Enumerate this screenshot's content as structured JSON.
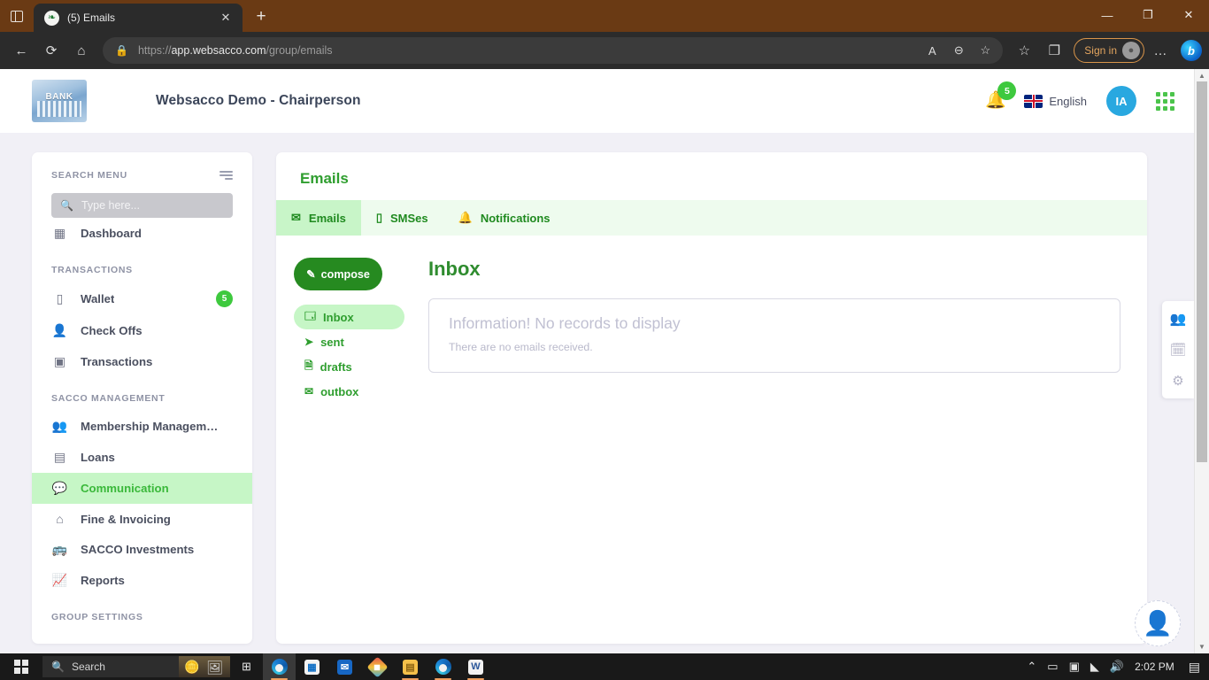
{
  "browser": {
    "tab_title": "(5) Emails",
    "tab_favicon": "leaf-icon",
    "new_tab_label": "+",
    "close_label": "✕",
    "minimize_label": "—",
    "maximize_label": "❐",
    "window_close_label": "✕",
    "back_label": "←",
    "reload_label": "⟳",
    "home_label": "⌂",
    "lock_label": "🔒",
    "url_prefix": "https://",
    "url_domain": "app.websacco.com",
    "url_path": "/group/emails",
    "read_aloud_label": "A",
    "zoom_label": "⊖",
    "add_favorite_label": "☆",
    "favorites_label": "☆",
    "collections_label": "❐",
    "signin_label": "Sign in",
    "more_label": "…",
    "bing_label": "b"
  },
  "app": {
    "logo_text": "BANK",
    "title": "Websacco Demo - Chairperson",
    "notification_count": "5",
    "language": "English",
    "avatar_initials": "IA"
  },
  "sidebar": {
    "search_header": "SEARCH MENU",
    "search_placeholder": "Type here...",
    "sections": [
      {
        "label": "",
        "items": [
          {
            "label": "Dashboard",
            "icon": "dashboard-icon",
            "badge": "",
            "active": false
          }
        ]
      },
      {
        "label": "TRANSACTIONS",
        "items": [
          {
            "label": "Wallet",
            "icon": "wallet-icon",
            "badge": "5",
            "active": false
          },
          {
            "label": "Check Offs",
            "icon": "check-offs-icon",
            "badge": "",
            "active": false
          },
          {
            "label": "Transactions",
            "icon": "transactions-icon",
            "badge": "",
            "active": false
          }
        ]
      },
      {
        "label": "SACCO MANAGEMENT",
        "items": [
          {
            "label": "Membership Managem…",
            "icon": "membership-icon",
            "badge": "",
            "active": false
          },
          {
            "label": "Loans",
            "icon": "loans-icon",
            "badge": "",
            "active": false
          },
          {
            "label": "Communication",
            "icon": "communication-icon",
            "badge": "",
            "active": true
          },
          {
            "label": "Fine & Invoicing",
            "icon": "fine-invoicing-icon",
            "badge": "",
            "active": false
          },
          {
            "label": "SACCO Investments",
            "icon": "investments-icon",
            "badge": "",
            "active": false
          },
          {
            "label": "Reports",
            "icon": "reports-icon",
            "badge": "",
            "active": false
          }
        ]
      },
      {
        "label": "GROUP SETTINGS",
        "items": []
      }
    ]
  },
  "main": {
    "card_title": "Emails",
    "tabs": [
      {
        "label": "Emails",
        "icon": "envelope-check-icon",
        "active": true
      },
      {
        "label": "SMSes",
        "icon": "mobile-icon",
        "active": false
      },
      {
        "label": "Notifications",
        "icon": "bell-icon",
        "active": false
      }
    ],
    "compose_label": "compose",
    "folders": [
      {
        "label": "Inbox",
        "icon": "inbox-icon",
        "active": true
      },
      {
        "label": "sent",
        "icon": "send-icon",
        "active": false
      },
      {
        "label": "drafts",
        "icon": "file-icon",
        "active": false
      },
      {
        "label": "outbox",
        "icon": "envelope-icon",
        "active": false
      }
    ],
    "inbox_title": "Inbox",
    "alert_title": "Information! No records to display",
    "alert_subtitle": "There are no emails received."
  },
  "widgets": {
    "items": [
      {
        "icon": "members-icon"
      },
      {
        "icon": "calendar-clock-icon"
      },
      {
        "icon": "gear-icon"
      }
    ],
    "support_icon": "headset-agent-icon"
  },
  "taskbar": {
    "search_placeholder": "Search",
    "clock": "2:02 PM",
    "apps": [
      {
        "name": "task-view",
        "glyph": "▯▮"
      },
      {
        "name": "edge-browser",
        "glyph": ""
      },
      {
        "name": "microsoft-store",
        "glyph": "▦"
      },
      {
        "name": "mail-app",
        "glyph": "✉"
      },
      {
        "name": "paint-app",
        "glyph": "◆"
      },
      {
        "name": "file-explorer",
        "glyph": "🗂"
      },
      {
        "name": "edge-browser-2",
        "glyph": ""
      },
      {
        "name": "word-app",
        "glyph": "W"
      }
    ],
    "tray": {
      "chevron": "⌃",
      "battery": "▭",
      "camera": "▣",
      "network": "◣",
      "volume": "🔊",
      "notifications": "▤"
    }
  },
  "colors": {
    "brand_green": "#2f9e2f",
    "accent_green": "#3ec93e",
    "highlight_green": "#c6f6c6",
    "page_bg": "#f1f0f6",
    "tabstrip_brown": "#6a3a14"
  }
}
